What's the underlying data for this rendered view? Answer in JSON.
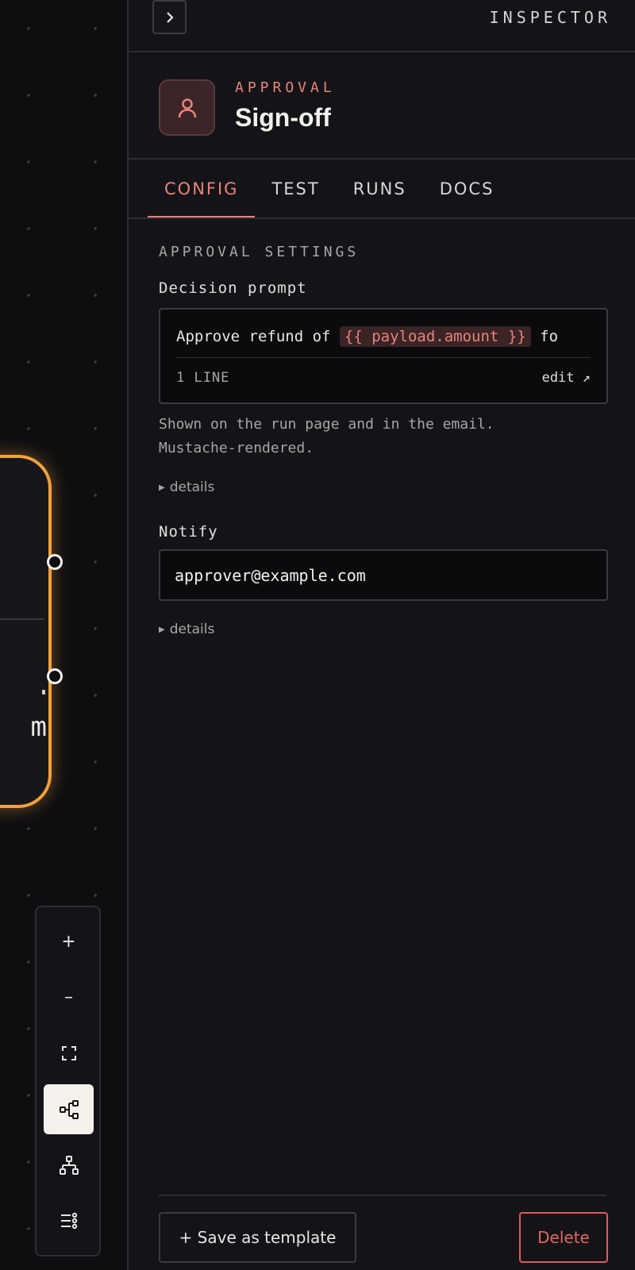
{
  "canvas": {
    "node_text_fragment": "m",
    "toolbar": [
      {
        "name": "zoom-in",
        "glyph": "+",
        "active": false
      },
      {
        "name": "zoom-out",
        "glyph": "–",
        "active": false
      },
      {
        "name": "fit-view",
        "icon": "fit-view-icon",
        "active": false
      },
      {
        "name": "layout-horizontal",
        "icon": "tree-horizontal-icon",
        "active": true
      },
      {
        "name": "layout-vertical",
        "icon": "tree-vertical-icon",
        "active": false
      },
      {
        "name": "list-layout",
        "icon": "list-icon",
        "active": false
      }
    ],
    "node_accent": "#f2a03d"
  },
  "inspector": {
    "collapse_icon": "chevron-right-icon",
    "title": "INSPECTOR",
    "node": {
      "kind": "APPROVAL",
      "name": "Sign-off",
      "icon": "user-icon",
      "accent": "#e8837a"
    },
    "tabs": [
      {
        "label": "CONFIG",
        "active": true
      },
      {
        "label": "TEST",
        "active": false
      },
      {
        "label": "RUNS",
        "active": false
      },
      {
        "label": "DOCS",
        "active": false
      }
    ],
    "section_title": "APPROVAL SETTINGS",
    "decision_prompt": {
      "label": "Decision prompt",
      "text_before": "Approve refund of ",
      "token": "{{ payload.amount }}",
      "text_after": " fo",
      "line_count": "1 LINE",
      "edit_label": "edit ↗",
      "help_line1": "Shown on the run page and in the email.",
      "help_line2": "Mustache-rendered.",
      "details_label": "details"
    },
    "notify": {
      "label": "Notify",
      "value": "approver@example.com",
      "details_label": "details"
    },
    "footer": {
      "save_label": "+ Save as template",
      "delete_label": "Delete",
      "delete_color": "#e05a5a"
    }
  }
}
